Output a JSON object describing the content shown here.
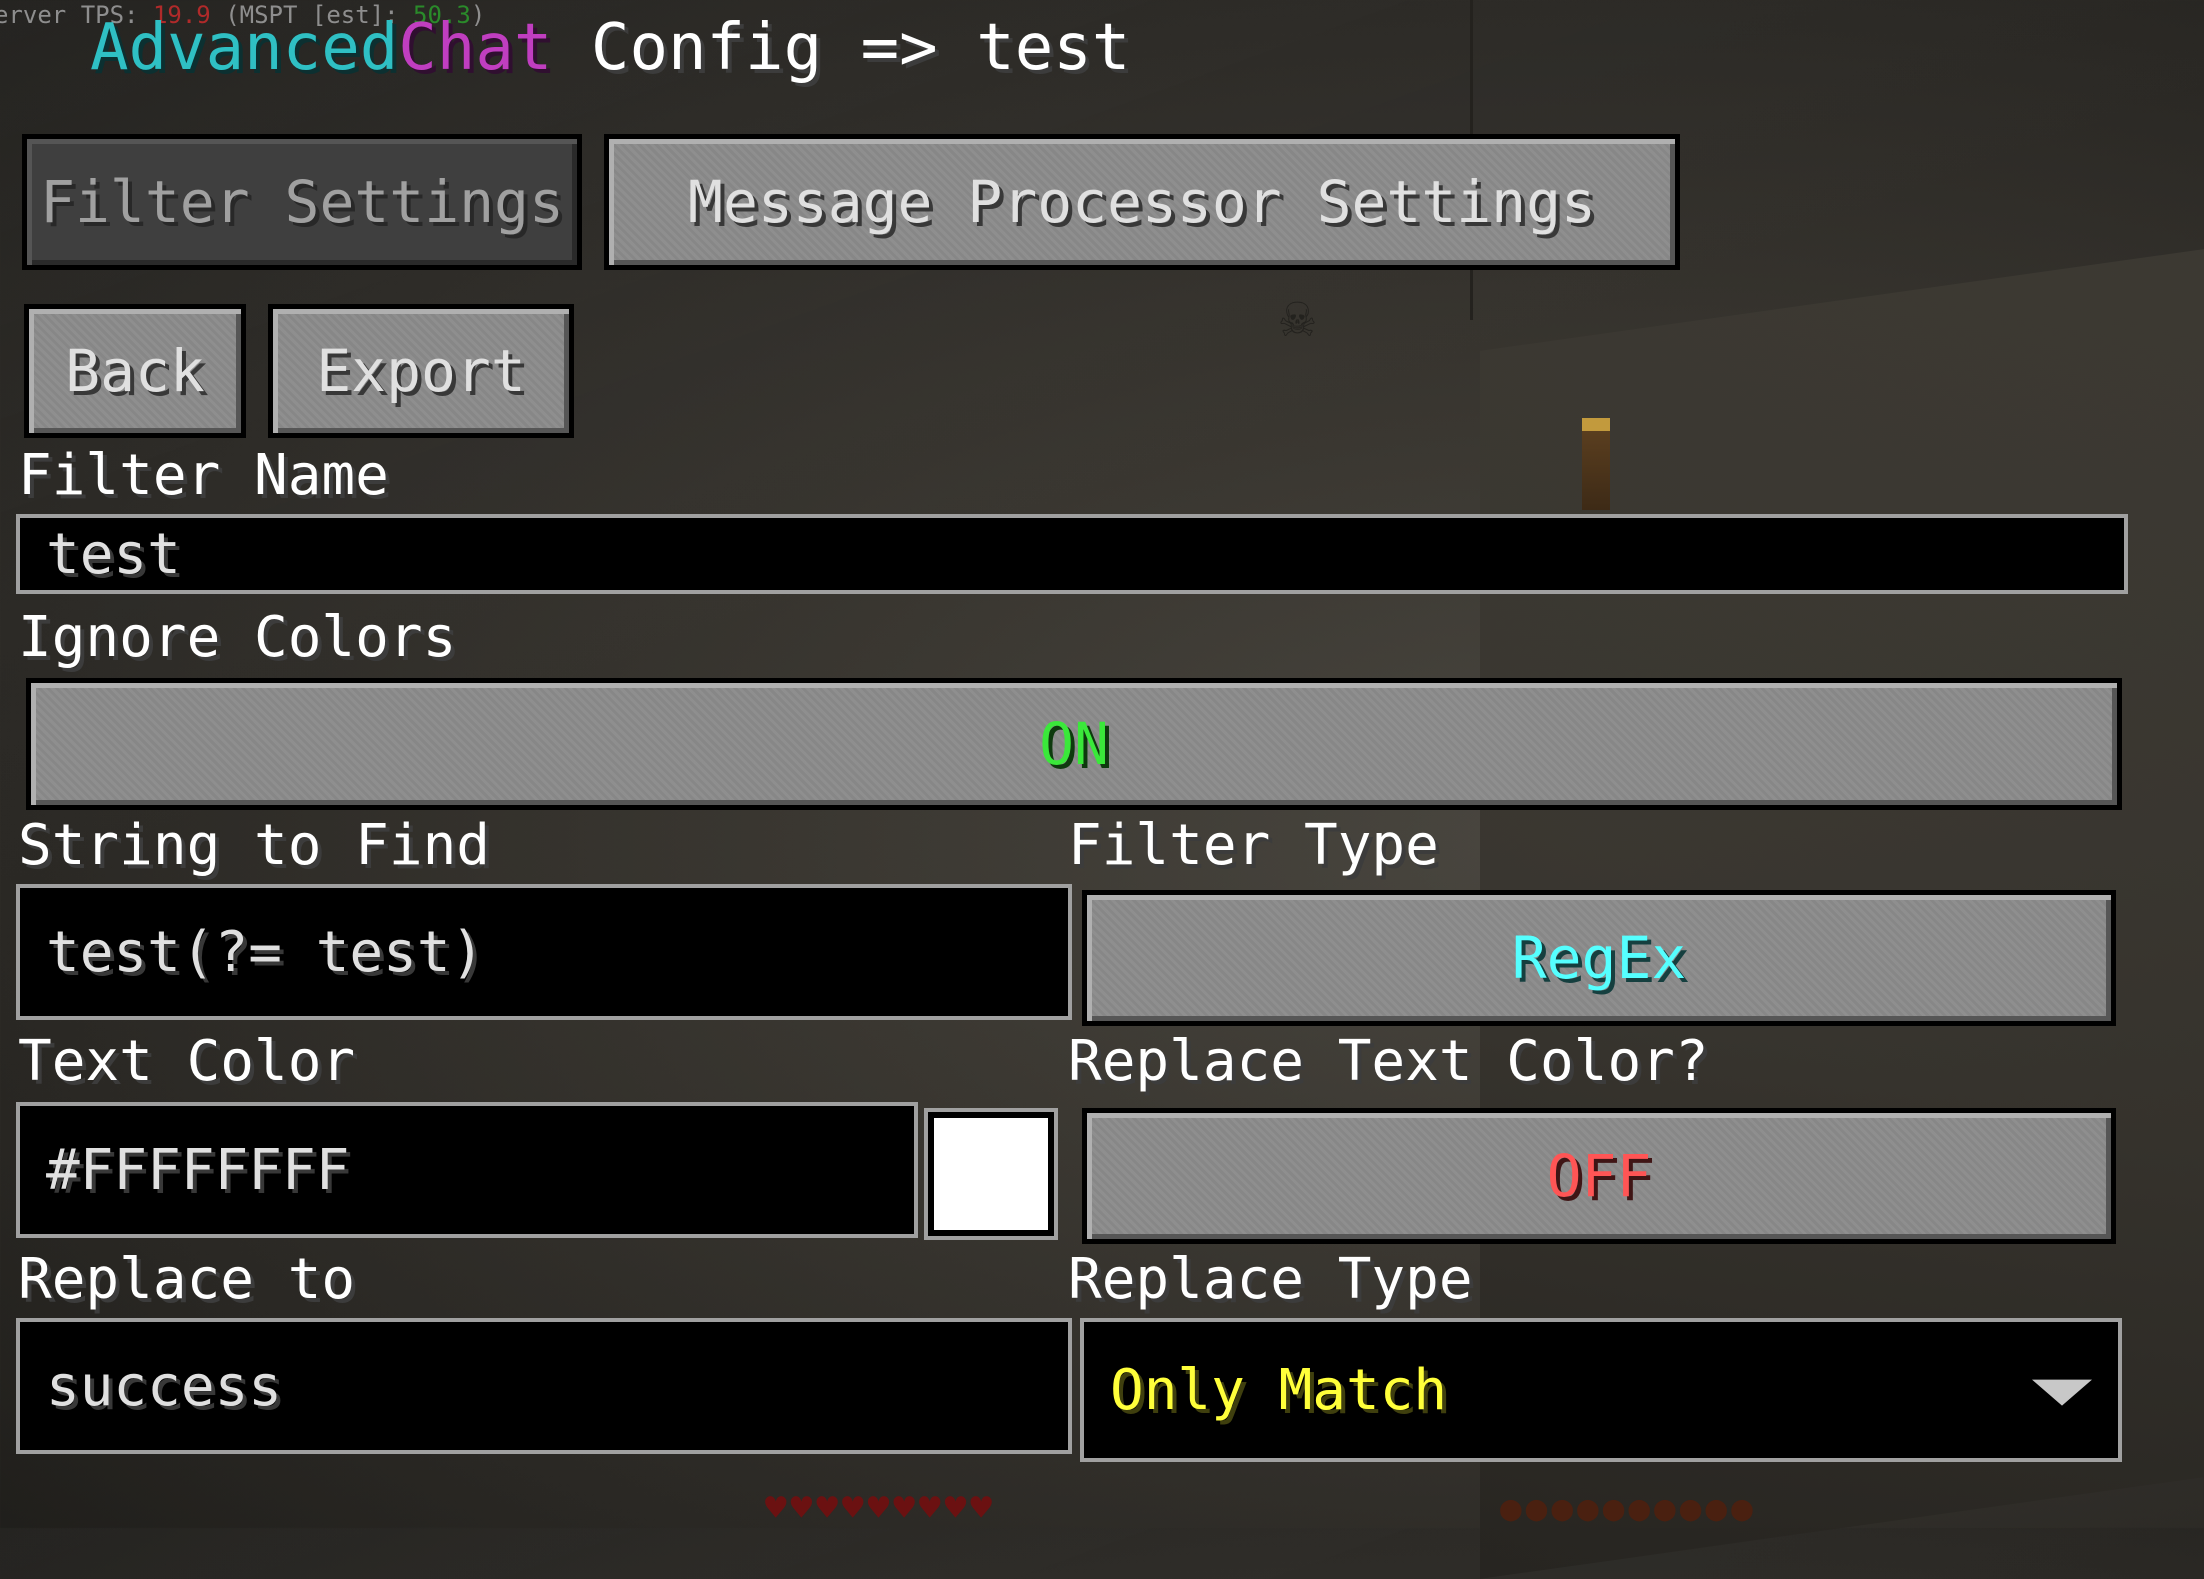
{
  "overlay": {
    "tps_prefix": "erver TPS: ",
    "tps_value": "19.9",
    "mspt_prefix": " (MSPT [est]: ",
    "mspt_value": "50.3",
    "mspt_suffix": ")"
  },
  "header": {
    "title_part1": "Advanced",
    "title_part2": "Chat",
    "title_rest": " Config => test",
    "colors": {
      "advanced": "#2fc0c4",
      "chat": "#c03ec0"
    }
  },
  "tabs": {
    "filter_settings": "Filter Settings",
    "message_processor_settings": "Message Processor Settings"
  },
  "actions": {
    "back": "Back",
    "export": "Export"
  },
  "form": {
    "filter_name": {
      "label": "Filter Name",
      "value": "test"
    },
    "ignore_colors": {
      "label": "Ignore Colors",
      "value": "ON",
      "color": "#3ae83a"
    },
    "string_to_find": {
      "label": "String to Find",
      "value": "test(?= test)"
    },
    "filter_type": {
      "label": "Filter Type",
      "value": "RegEx",
      "color": "#55ffff"
    },
    "text_color": {
      "label": "Text Color",
      "value": "#FFFFFFFF",
      "swatch_color": "#ffffff"
    },
    "replace_text_color": {
      "label": "Replace Text Color?",
      "value": "OFF",
      "color": "#ff5555"
    },
    "replace_to": {
      "label": "Replace to",
      "value": "success"
    },
    "replace_type": {
      "label": "Replace Type",
      "value": "Only Match",
      "color": "#ffff3a",
      "icon": "dropdown-arrow-icon"
    }
  }
}
